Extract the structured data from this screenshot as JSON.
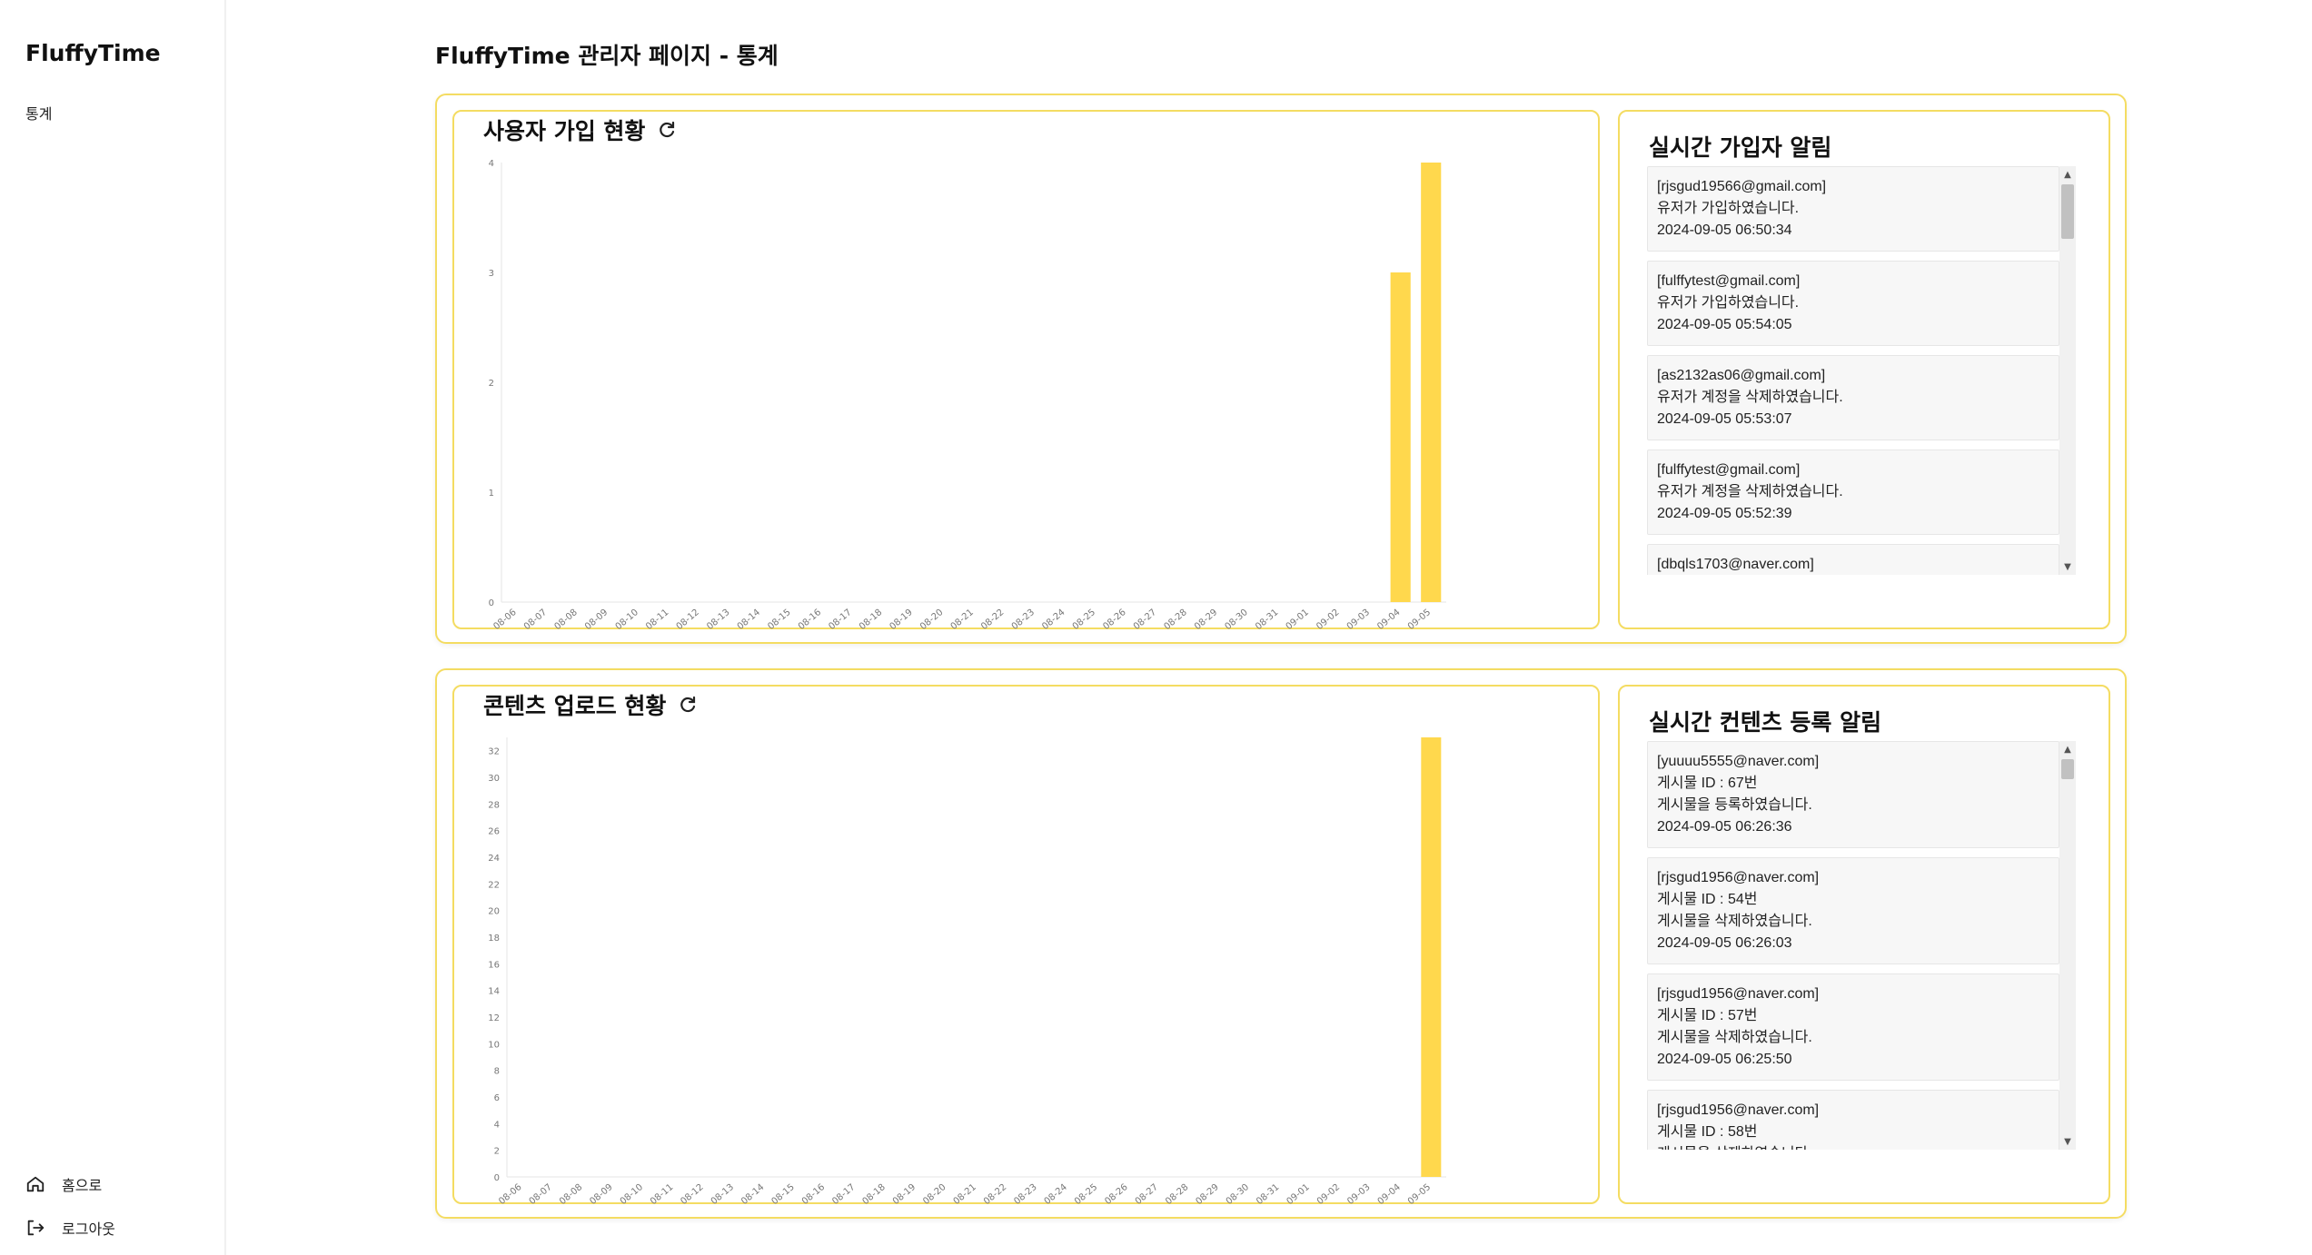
{
  "sidebar": {
    "brand": "FluffyTime",
    "nav_stat": "통계",
    "home_label": "홈으로",
    "logout_label": "로그아웃"
  },
  "page_title": "FluffyTime 관리자 페이지 - 통계",
  "colors": {
    "accent": "#ffd84d",
    "border": "#f4dc62"
  },
  "signup_section": {
    "chart_title": "사용자 가입 현황",
    "alert_title": "실시간 가입자 알림",
    "alerts": [
      {
        "email": "[rjsgud19566@gmail.com]",
        "message": "유저가 가입하였습니다.",
        "time": "2024-09-05 06:50:34"
      },
      {
        "email": "[fulffytest@gmail.com]",
        "message": "유저가 가입하였습니다.",
        "time": "2024-09-05 05:54:05"
      },
      {
        "email": "[as2132as06@gmail.com]",
        "message": "유저가 계정을 삭제하였습니다.",
        "time": "2024-09-05 05:53:07"
      },
      {
        "email": "[fulffytest@gmail.com]",
        "message": "유저가 계정을 삭제하였습니다.",
        "time": "2024-09-05 05:52:39"
      },
      {
        "email": "[dbqls1703@naver.com]",
        "message": "",
        "time": ""
      }
    ]
  },
  "content_section": {
    "chart_title": "콘텐츠 업로드 현황",
    "alert_title": "실시간 컨텐츠 등록 알림",
    "alerts": [
      {
        "email": "[yuuuu5555@naver.com]",
        "post_id": "게시물 ID : 67번",
        "message": "게시물을 등록하였습니다.",
        "time": "2024-09-05 06:26:36"
      },
      {
        "email": "[rjsgud1956@naver.com]",
        "post_id": "게시물 ID : 54번",
        "message": "게시물을 삭제하였습니다.",
        "time": "2024-09-05 06:26:03"
      },
      {
        "email": "[rjsgud1956@naver.com]",
        "post_id": "게시물 ID : 57번",
        "message": "게시물을 삭제하였습니다.",
        "time": "2024-09-05 06:25:50"
      },
      {
        "email": "[rjsgud1956@naver.com]",
        "post_id": "게시물 ID : 58번",
        "message": "게시물을 삭제하였습니다.",
        "time": ""
      }
    ]
  },
  "chart_data": [
    {
      "type": "bar",
      "categories": [
        "08-06",
        "08-07",
        "08-08",
        "08-09",
        "08-10",
        "08-11",
        "08-12",
        "08-13",
        "08-14",
        "08-15",
        "08-16",
        "08-17",
        "08-18",
        "08-19",
        "08-20",
        "08-21",
        "08-22",
        "08-23",
        "08-24",
        "08-25",
        "08-26",
        "08-27",
        "08-28",
        "08-29",
        "08-30",
        "08-31",
        "09-01",
        "09-02",
        "09-03",
        "09-04",
        "09-05"
      ],
      "values": [
        0,
        0,
        0,
        0,
        0,
        0,
        0,
        0,
        0,
        0,
        0,
        0,
        0,
        0,
        0,
        0,
        0,
        0,
        0,
        0,
        0,
        0,
        0,
        0,
        0,
        0,
        0,
        0,
        0,
        3,
        4
      ],
      "yticks": [
        0,
        1,
        2,
        3,
        4
      ],
      "ylim": [
        0,
        4
      ],
      "title": "사용자 가입 현황",
      "grid": false,
      "color": "#ffd84d"
    },
    {
      "type": "bar",
      "categories": [
        "08-06",
        "08-07",
        "08-08",
        "08-09",
        "08-10",
        "08-11",
        "08-12",
        "08-13",
        "08-14",
        "08-15",
        "08-16",
        "08-17",
        "08-18",
        "08-19",
        "08-20",
        "08-21",
        "08-22",
        "08-23",
        "08-24",
        "08-25",
        "08-26",
        "08-27",
        "08-28",
        "08-29",
        "08-30",
        "08-31",
        "09-01",
        "09-02",
        "09-03",
        "09-04",
        "09-05"
      ],
      "values": [
        0,
        0,
        0,
        0,
        0,
        0,
        0,
        0,
        0,
        0,
        0,
        0,
        0,
        0,
        0,
        0,
        0,
        0,
        0,
        0,
        0,
        0,
        0,
        0,
        0,
        0,
        0,
        0,
        0,
        0,
        33
      ],
      "yticks": [
        0,
        2,
        4,
        6,
        8,
        10,
        12,
        14,
        16,
        18,
        20,
        22,
        24,
        26,
        28,
        30,
        32
      ],
      "ylim": [
        0,
        33
      ],
      "title": "콘텐츠 업로드 현황",
      "grid": false,
      "color": "#ffd84d"
    }
  ]
}
